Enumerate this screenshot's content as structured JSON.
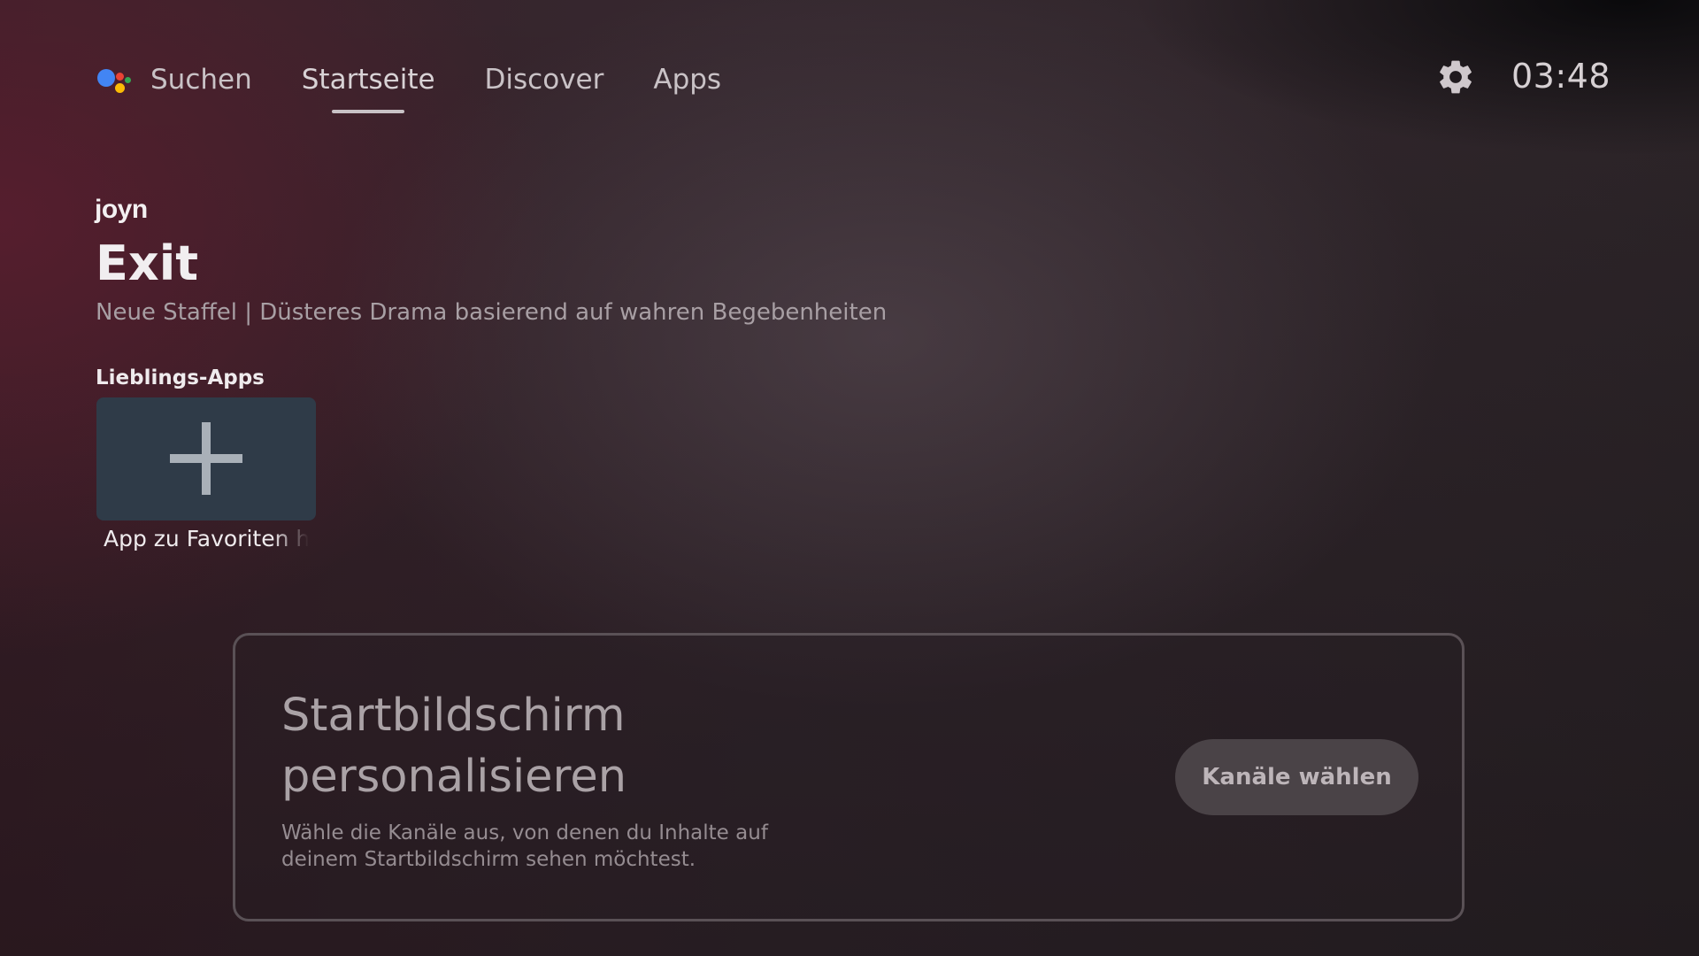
{
  "nav": {
    "items": [
      {
        "label": "Suchen"
      },
      {
        "label": "Startseite",
        "active": true
      },
      {
        "label": "Discover"
      },
      {
        "label": "Apps"
      }
    ]
  },
  "status": {
    "settings_icon": "gear-icon",
    "clock": "03:48"
  },
  "featured": {
    "provider_logo": "joyn",
    "title": "Exit",
    "subtitle": "Neue Staffel | Düsteres Drama basierend auf wahren Begebenheiten"
  },
  "favorites": {
    "row_title": "Lieblings-Apps",
    "add_tile_icon": "plus-icon",
    "add_tile_label": "App zu Favoriten hinzufügen"
  },
  "personalize": {
    "title_line1": "Startbildschirm",
    "title_line2": "personalisieren",
    "description": "Wähle die Kanäle aus, von denen du Inhalte auf deinem Startbildschirm sehen möchtest.",
    "button_label": "Kanäle wählen"
  },
  "colors": {
    "assistant_blue": "#4285f4",
    "assistant_red": "#ea4335",
    "assistant_yellow": "#fbbc05",
    "assistant_green": "#34a853",
    "tile_background": "#2f3b48"
  }
}
